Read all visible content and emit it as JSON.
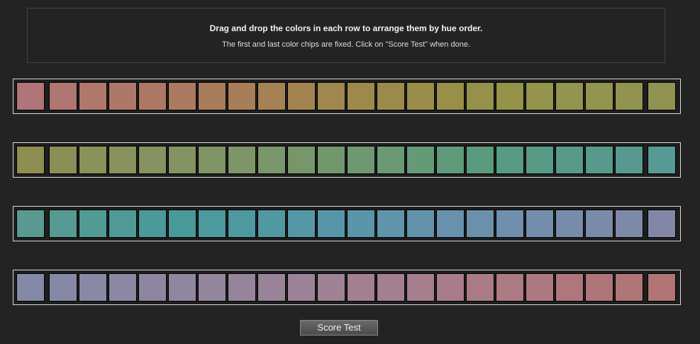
{
  "instructions": {
    "title": "Drag and drop the colors in each row to arrange them by hue order.",
    "subtitle": "The first and last color chips are fixed. Click on \"Score Test\" when done."
  },
  "score_button_label": "Score Test",
  "rows": [
    [
      "#b07578",
      "#b07672",
      "#b0776d",
      "#ae7868",
      "#ad7863",
      "#ab7a60",
      "#a97c5c",
      "#a77e58",
      "#a58155",
      "#a38451",
      "#a0864f",
      "#9e894d",
      "#9b8b4b",
      "#9a8d4a",
      "#988f49",
      "#96914a",
      "#949349",
      "#94944c",
      "#93944d",
      "#93944f",
      "#929351",
      "#919152"
    ],
    [
      "#8e8e50",
      "#8b8f55",
      "#8a9159",
      "#88925c",
      "#86925f",
      "#839462",
      "#819465",
      "#7e9567",
      "#7b966a",
      "#77976b",
      "#72976d",
      "#6e986f",
      "#699a73",
      "#649a77",
      "#5f9a7a",
      "#5b9a7d",
      "#589a82",
      "#579a85",
      "#579a89",
      "#57998d",
      "#579991",
      "#579994"
    ],
    [
      "#5a9991",
      "#579a93",
      "#529a94",
      "#4f9a97",
      "#4b9998",
      "#4a999a",
      "#4c999e",
      "#4e99a0",
      "#5198a3",
      "#5597a6",
      "#5796a8",
      "#5a95aa",
      "#5f94ab",
      "#6393ab",
      "#6791ac",
      "#6b90ac",
      "#6f8fac",
      "#738eac",
      "#778cab",
      "#7a8ba9",
      "#7e89a8",
      "#8387a7"
    ],
    [
      "#8589a8",
      "#8689a6",
      "#8988a5",
      "#8c88a3",
      "#8e86a1",
      "#91869f",
      "#93869d",
      "#96849b",
      "#998399",
      "#9c8397",
      "#9f8295",
      "#a28092",
      "#a47f90",
      "#a67e8d",
      "#a87c8a",
      "#aa7b87",
      "#ac7a83",
      "#ad7880",
      "#ae777d",
      "#af767a",
      "#b07577",
      "#b07574"
    ]
  ]
}
